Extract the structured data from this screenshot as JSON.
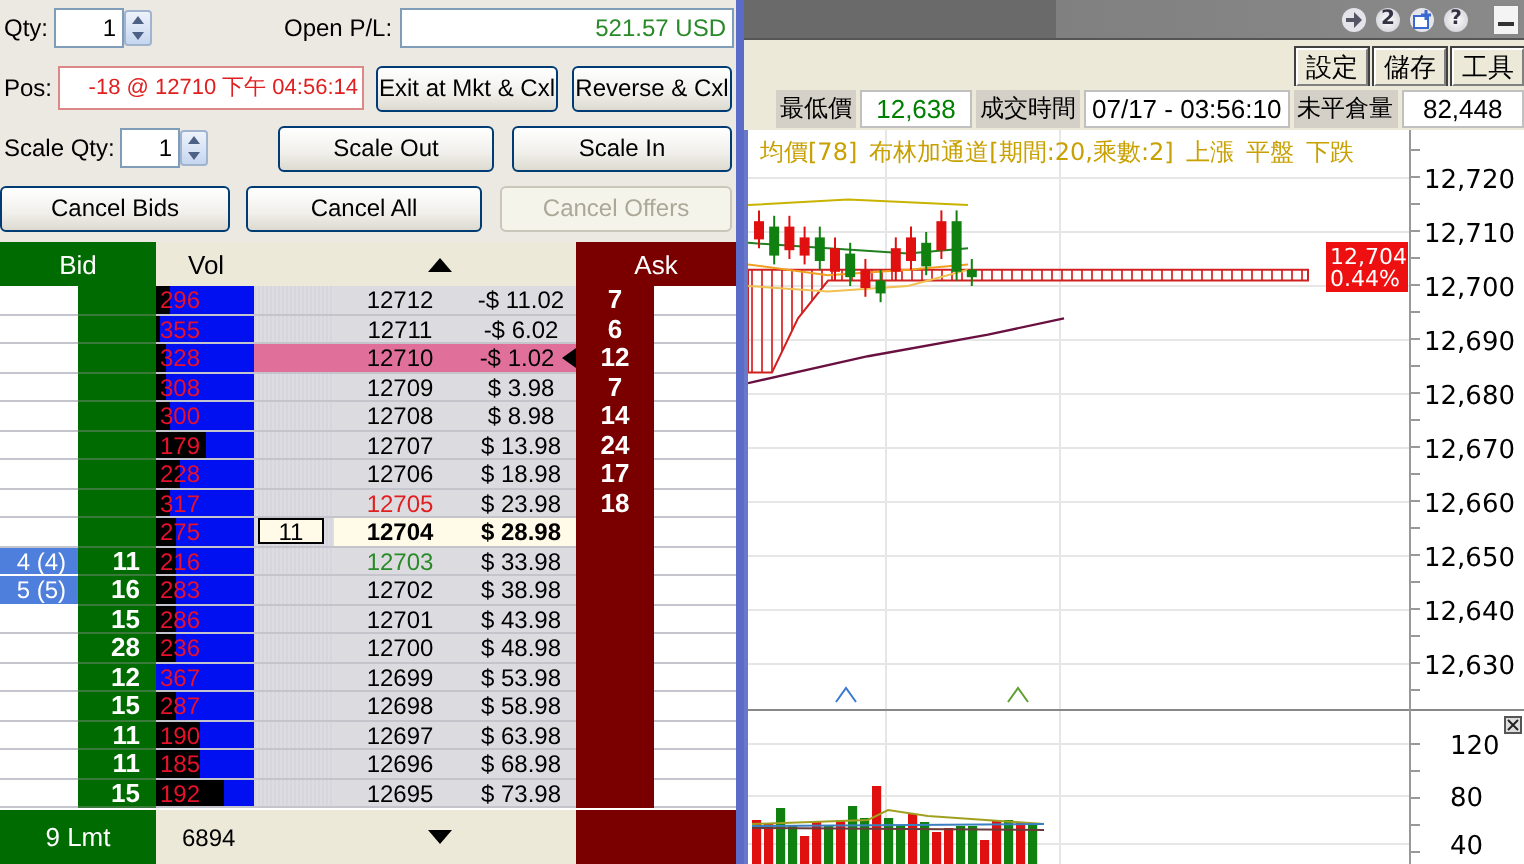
{
  "order_panel": {
    "qty": {
      "label": "Qty:",
      "value": "1"
    },
    "open_pl": {
      "label": "Open P/L:",
      "value": "521.57 USD"
    },
    "position": {
      "label": "Pos:",
      "value": "-18 @ 12710 下午 04:56:14"
    },
    "scale_qty": {
      "label": "Scale Qty:",
      "value": "1"
    },
    "buttons": [
      {
        "label": "Exit at Mkt & Cxl",
        "disabled": false
      },
      {
        "label": "Reverse & Cxl",
        "disabled": false
      },
      {
        "label": "Scale Out",
        "disabled": false
      },
      {
        "label": "Scale In",
        "disabled": false
      },
      {
        "label": "Cancel Bids",
        "disabled": false
      },
      {
        "label": "Cancel All",
        "disabled": false
      },
      {
        "label": "Cancel Offers",
        "disabled": true
      }
    ]
  },
  "ladder": {
    "columns": {
      "bid": "Bid",
      "vol": "Vol",
      "ask": "Ask"
    },
    "rows": [
      {
        "kind": "level",
        "orders": "",
        "bid": "",
        "vol": "296",
        "level": 0.85,
        "price": "12712",
        "price_high": false,
        "price_low": false,
        "pl": "-$ 11.02",
        "ask": "7",
        "selected": false
      },
      {
        "kind": "level",
        "orders": "",
        "bid": "",
        "vol": "355",
        "level": 0.95,
        "price": "12711",
        "price_high": false,
        "price_low": false,
        "pl": "-$ 6.02",
        "ask": "6",
        "selected": false
      },
      {
        "kind": "level",
        "orders": "",
        "bid": "",
        "vol": "328",
        "level": 0.9,
        "price": "12710",
        "price_high": false,
        "price_low": false,
        "pl": "-$ 1.02",
        "ask": "12",
        "selected": true
      },
      {
        "kind": "level",
        "orders": "",
        "bid": "",
        "vol": "308",
        "level": 0.9,
        "price": "12709",
        "price_high": false,
        "price_low": false,
        "pl": "$ 3.98",
        "ask": "7",
        "selected": false
      },
      {
        "kind": "level",
        "orders": "",
        "bid": "",
        "vol": "300",
        "level": 0.85,
        "price": "12708",
        "price_high": false,
        "price_low": false,
        "pl": "$ 8.98",
        "ask": "14",
        "selected": false
      },
      {
        "kind": "level",
        "orders": "",
        "bid": "",
        "vol": "179",
        "level": 0.5,
        "price": "12707",
        "price_high": false,
        "price_low": false,
        "pl": "$ 13.98",
        "ask": "24",
        "selected": false
      },
      {
        "kind": "level",
        "orders": "",
        "bid": "",
        "vol": "228",
        "level": 0.75,
        "price": "12706",
        "price_high": false,
        "price_low": false,
        "pl": "$ 18.98",
        "ask": "17",
        "selected": false
      },
      {
        "kind": "level",
        "orders": "",
        "bid": "",
        "vol": "317",
        "level": 0.85,
        "price": "12705",
        "price_high": true,
        "price_low": false,
        "pl": "$ 23.98",
        "ask": "18",
        "selected": false
      },
      {
        "kind": "last",
        "entry_qty": "11",
        "orders": "",
        "bid": "",
        "vol": "275",
        "level": 0.8,
        "price": "12704",
        "price_high": false,
        "price_low": false,
        "pl": "$ 28.98",
        "ask": "",
        "selected": false
      },
      {
        "kind": "level",
        "orders": "4 (4)",
        "bid": "11",
        "vol": "216",
        "level": 0.8,
        "price": "12703",
        "price_high": false,
        "price_low": true,
        "pl": "$ 33.98",
        "ask": "",
        "selected": false
      },
      {
        "kind": "level",
        "orders": "5 (5)",
        "bid": "16",
        "vol": "283",
        "level": 0.8,
        "price": "12702",
        "price_high": false,
        "price_low": false,
        "pl": "$ 38.98",
        "ask": "",
        "selected": false
      },
      {
        "kind": "level",
        "orders": "",
        "bid": "15",
        "vol": "286",
        "level": 0.8,
        "price": "12701",
        "price_high": false,
        "price_low": false,
        "pl": "$ 43.98",
        "ask": "",
        "selected": false
      },
      {
        "kind": "level",
        "orders": "",
        "bid": "28",
        "vol": "236",
        "level": 0.8,
        "price": "12700",
        "price_high": false,
        "price_low": false,
        "pl": "$ 48.98",
        "ask": "",
        "selected": false
      },
      {
        "kind": "level",
        "orders": "",
        "bid": "12",
        "vol": "367",
        "level": 1,
        "price": "12699",
        "price_high": false,
        "price_low": false,
        "pl": "$ 53.98",
        "ask": "",
        "selected": false
      },
      {
        "kind": "level",
        "orders": "",
        "bid": "15",
        "vol": "287",
        "level": 0.8,
        "price": "12698",
        "price_high": false,
        "price_low": false,
        "pl": "$ 58.98",
        "ask": "",
        "selected": false
      },
      {
        "kind": "level",
        "orders": "",
        "bid": "11",
        "vol": "190",
        "level": 0.55,
        "price": "12697",
        "price_high": false,
        "price_low": false,
        "pl": "$ 63.98",
        "ask": "",
        "selected": false
      },
      {
        "kind": "level",
        "orders": "",
        "bid": "11",
        "vol": "185",
        "level": 0.55,
        "price": "12696",
        "price_high": false,
        "price_low": false,
        "pl": "$ 68.98",
        "ask": "",
        "selected": false
      },
      {
        "kind": "level",
        "orders": "",
        "bid": "15",
        "vol": "192",
        "level": 0.3,
        "price": "12695",
        "price_high": false,
        "price_low": false,
        "pl": "$ 73.98",
        "ask": "",
        "selected": false
      }
    ],
    "footer": {
      "bid": "9 Lmt",
      "vol": "6894"
    }
  },
  "chart_window": {
    "title_icons": {
      "page": "2",
      "help": "?"
    },
    "toolbar_buttons": [
      "設定",
      "儲存",
      "工具"
    ],
    "quote": [
      {
        "label": "最低價",
        "value": "12,638",
        "color": "#008000"
      },
      {
        "label": "成交時間",
        "value": "07/17 - 03:56:10",
        "color": "#000000"
      },
      {
        "label": "未平倉量",
        "value": "82,448",
        "color": "#000000"
      }
    ],
    "legend": [
      "均價[78]",
      "布林加通道[期間:20,乘數:2]",
      "上漲",
      "平盤",
      "下跌"
    ],
    "price_axis": [
      "12,720",
      "12,710",
      "12,700",
      "12,690",
      "12,680",
      "12,670",
      "12,660",
      "12,650",
      "12,640",
      "12,630"
    ],
    "price_tag": {
      "price": "12,704",
      "change": "0.44%"
    },
    "volume_axis": [
      "120",
      "80",
      "40"
    ]
  }
}
